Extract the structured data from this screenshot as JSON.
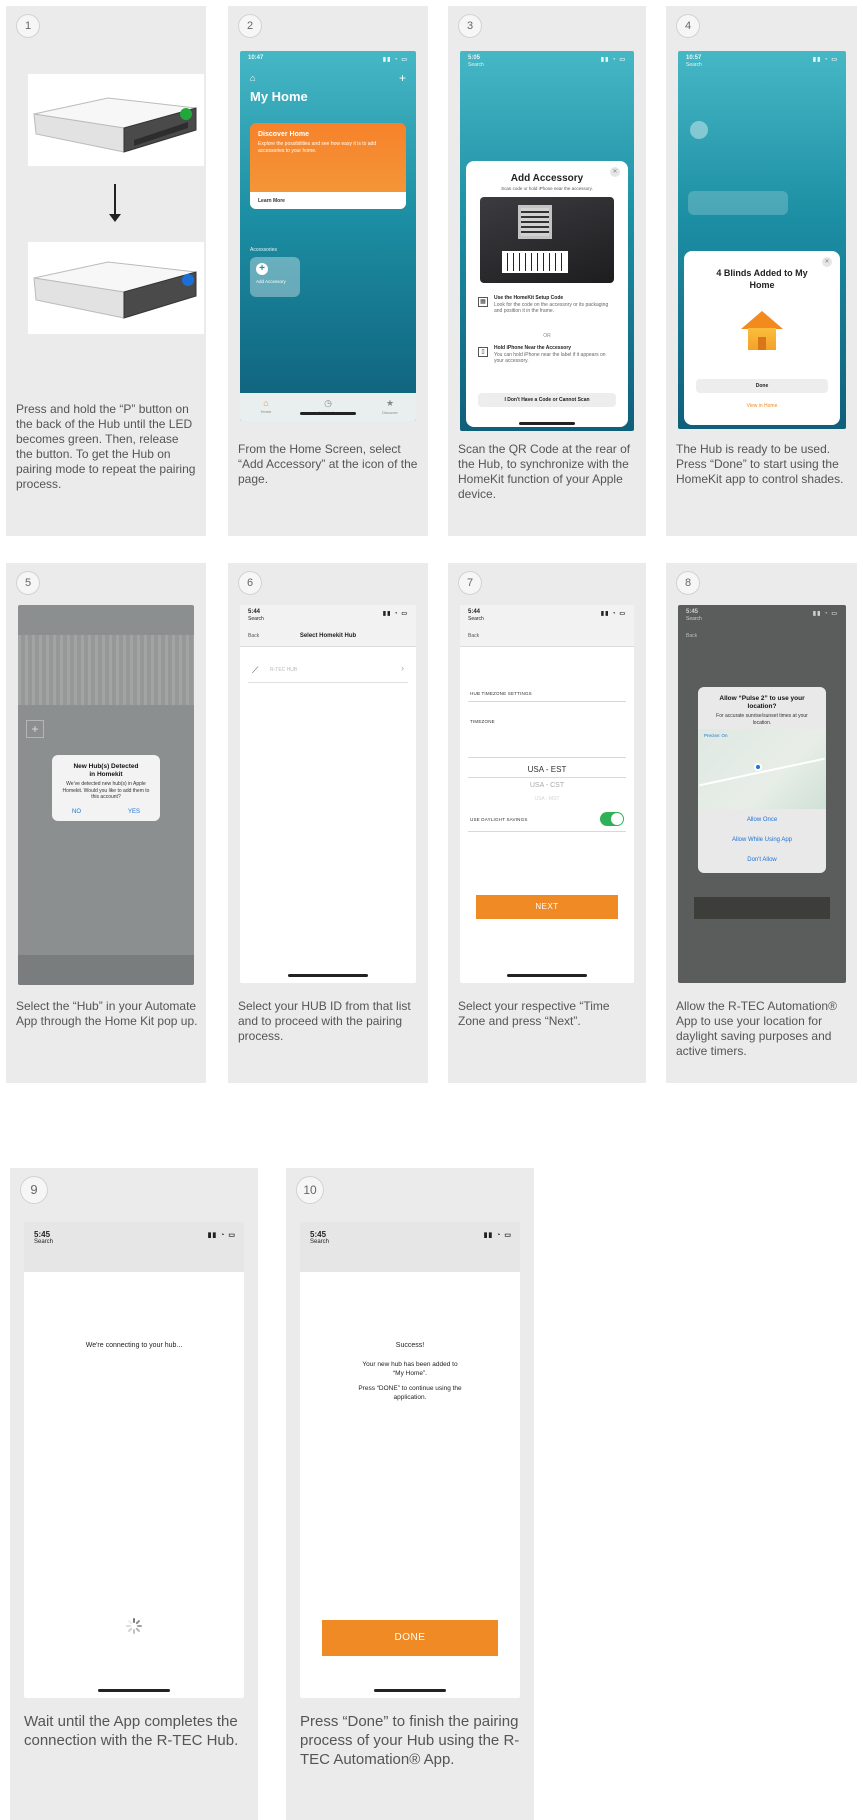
{
  "steps": [
    {
      "num": "1",
      "caption": "Press and hold the “P” button on the back of the Hub until the LED becomes green. Then, release the button. To get the Hub on pairing mode to repeat the pairing process."
    },
    {
      "num": "2",
      "caption": "From the Home Screen, select “Add Accessory” at the icon of the page."
    },
    {
      "num": "3",
      "caption": "Scan the QR Code at the rear of the Hub, to synchronize with the HomeKit function of your Apple device."
    },
    {
      "num": "4",
      "caption": "The Hub is ready to be used. Press “Done” to start using the HomeKit app to control shades."
    },
    {
      "num": "5",
      "caption": "Select the “Hub” in your Automate App through the Home Kit pop up."
    },
    {
      "num": "6",
      "caption": "Select your HUB ID from that list and to proceed with the pairing process."
    },
    {
      "num": "7",
      "caption": "Select your respective “Time Zone and press “Next”."
    },
    {
      "num": "8",
      "caption": "Allow the R-TEC Automation® App to use your location for daylight saving purposes and active timers."
    },
    {
      "num": "9",
      "caption": "Wait until the App completes the connection with the R-TEC Hub."
    },
    {
      "num": "10",
      "caption": "Press “Done” to finish the pairing process of your Hub using the R-TEC Automation® App."
    }
  ],
  "s2": {
    "time": "10:47",
    "title": "My Home",
    "card_title": "Discover Home",
    "card_body": "Explore the possibilities and see how easy it is to add accessories to your home.",
    "card_link": "Learn More",
    "section": "Accessories",
    "tile_label": "Add Accessory",
    "tabs": [
      "Home",
      "Automation",
      "Discover"
    ]
  },
  "s3": {
    "time": "5:05",
    "sub": "Search",
    "title": "Add Accessory",
    "subtitle": "Scan code or hold iPhone near the accessory.",
    "opt1_title": "Use the HomeKit Setup Code",
    "opt1_body": "Look for the code on the accessory or its packaging and position it in the frame.",
    "or": "OR",
    "opt2_title": "Hold iPhone Near the Accessory",
    "opt2_body": "You can hold iPhone near the label if it appears on your accessory.",
    "button": "I Don't Have a Code or Cannot Scan"
  },
  "s4": {
    "time": "10:57",
    "sub": "Search",
    "title": "4 Blinds Added to My Home",
    "done": "Done",
    "view": "View in Home"
  },
  "s5": {
    "alert_title": "New Hub(s) Detected in Homekit",
    "alert_body": "We’ve detected new hub(s) in Apple Homekit. Would you like to add them to this account?",
    "no": "NO",
    "yes": "YES"
  },
  "s6": {
    "time": "5:44",
    "sub": "Search",
    "back": "Back",
    "title": "Select Homekit Hub",
    "row": "R-TEC HUB"
  },
  "s7": {
    "time": "5:44",
    "sub": "Search",
    "back": "Back",
    "hub_tz": "HUB TIMEZONE SETTINGS",
    "tz": "TIMEZONE",
    "picker": [
      "USA - EST",
      "USA - CST",
      "USA - MST"
    ],
    "dst": "USE DAYLIGHT SAVINGS",
    "next": "NEXT"
  },
  "s8": {
    "time": "5:45",
    "sub": "Search",
    "back": "Back",
    "alert_title": "Allow “Pulse 2” to use your location?",
    "alert_body": "For accurate sunrise/sunset times at your location.",
    "map_label": "Precise: On",
    "opt1": "Allow Once",
    "opt2": "Allow While Using App",
    "opt3": "Don't Allow"
  },
  "s9": {
    "time": "5:45",
    "sub": "Search",
    "message": "We're connecting to your hub..."
  },
  "s10": {
    "time": "5:45",
    "sub": "Search",
    "success": "Success!",
    "line1": "Your new hub has been added to “My Home”.",
    "line2": "Press “DONE” to continue using the application.",
    "done": "DONE"
  },
  "colors": {
    "card_bg": "#ebebeb",
    "accent_orange": "#f08a24",
    "teal": "#1c8ea3",
    "led_green": "#22a83a",
    "led_blue": "#1d6fd8"
  }
}
